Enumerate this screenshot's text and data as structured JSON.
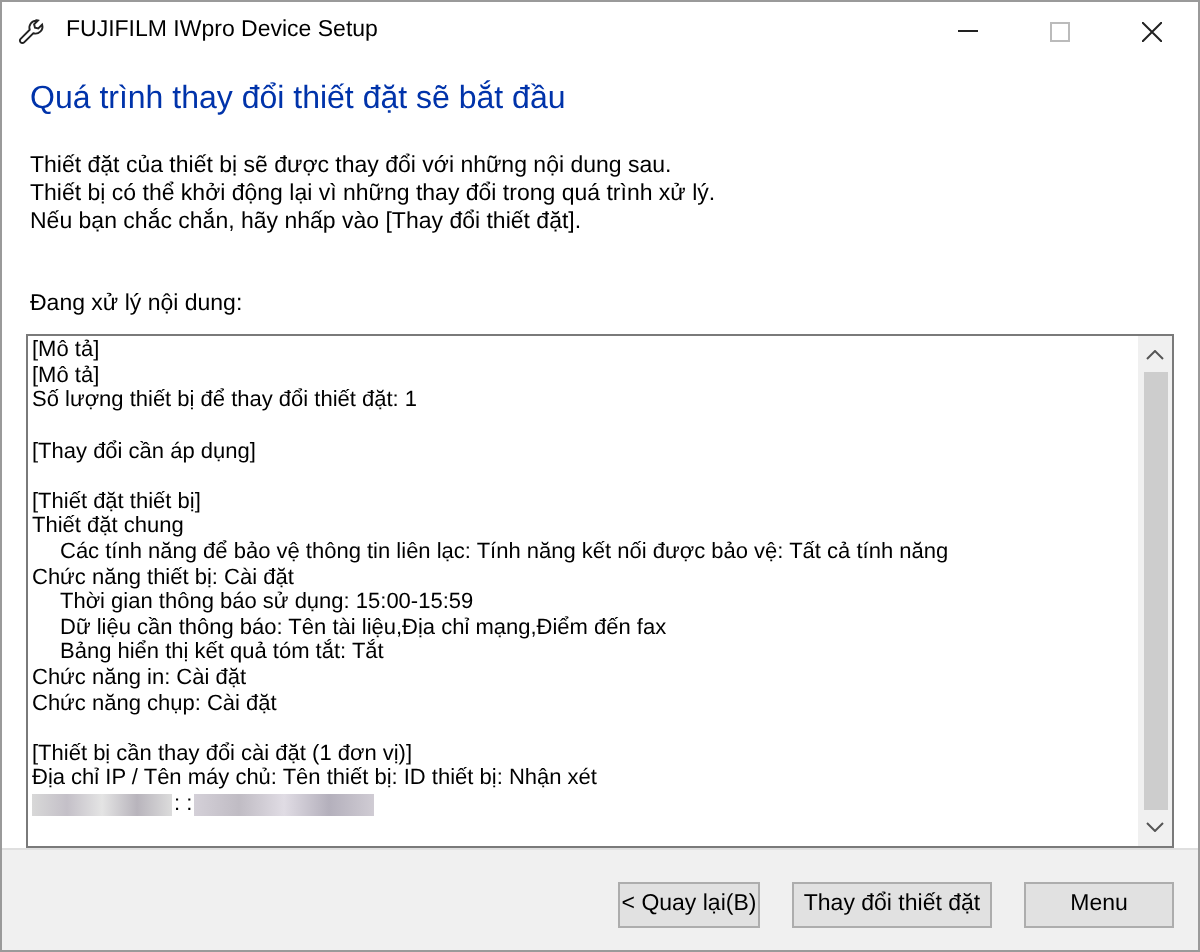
{
  "window": {
    "title": "FUJIFILM IWpro Device Setup"
  },
  "heading": "Quá trình thay đổi thiết đặt sẽ bắt đầu",
  "intro": [
    "Thiết đặt của thiết bị sẽ được thay đổi với những nội dung sau.",
    "Thiết bị có thể khởi động lại vì những thay đổi trong quá trình xử lý.",
    "Nếu bạn chắc chắn, hãy nhấp vào [Thay đổi thiết đặt]."
  ],
  "details_label": "Đang xử lý nội dung:",
  "details": [
    {
      "kind": "line",
      "text": "[Mô tả]"
    },
    {
      "kind": "line",
      "text": "[Mô tả]"
    },
    {
      "kind": "line",
      "text": "Số lượng thiết bị để thay đổi thiết đặt: 1"
    },
    {
      "kind": "blank"
    },
    {
      "kind": "line",
      "text": "[Thay đổi cần áp dụng]"
    },
    {
      "kind": "blank"
    },
    {
      "kind": "line",
      "text": "[Thiết đặt thiết bị]"
    },
    {
      "kind": "line",
      "text": "Thiết đặt chung"
    },
    {
      "kind": "indented",
      "text": "Các tính năng để bảo vệ thông tin liên lạc: Tính năng kết nối được bảo vệ: Tất cả tính năng"
    },
    {
      "kind": "line",
      "text": "Chức năng thiết bị: Cài đặt"
    },
    {
      "kind": "indented",
      "text": "Thời gian thông báo sử dụng: 15:00-15:59"
    },
    {
      "kind": "indented",
      "text": "Dữ liệu cần thông báo: Tên tài liệu,Địa chỉ mạng,Điểm đến fax"
    },
    {
      "kind": "indented",
      "text": "Bảng hiển thị kết quả tóm tắt: Tắt"
    },
    {
      "kind": "line",
      "text": "Chức năng in: Cài đặt"
    },
    {
      "kind": "line",
      "text": "Chức năng chụp: Cài đặt"
    },
    {
      "kind": "blank"
    },
    {
      "kind": "line",
      "text": "[Thiết bị cần thay đổi cài đặt (1 đơn vị)]"
    },
    {
      "kind": "line",
      "text": "Địa chỉ IP / Tên máy chủ: Tên thiết bị: ID thiết bị: Nhận xét"
    },
    {
      "kind": "masked",
      "text": ": :"
    }
  ],
  "buttons": [
    {
      "label": "< Quay lại(B)",
      "kind": "back"
    },
    {
      "label": "Thay đổi thiết đặt",
      "kind": "apply"
    },
    {
      "label": "Menu",
      "kind": "menu"
    }
  ]
}
